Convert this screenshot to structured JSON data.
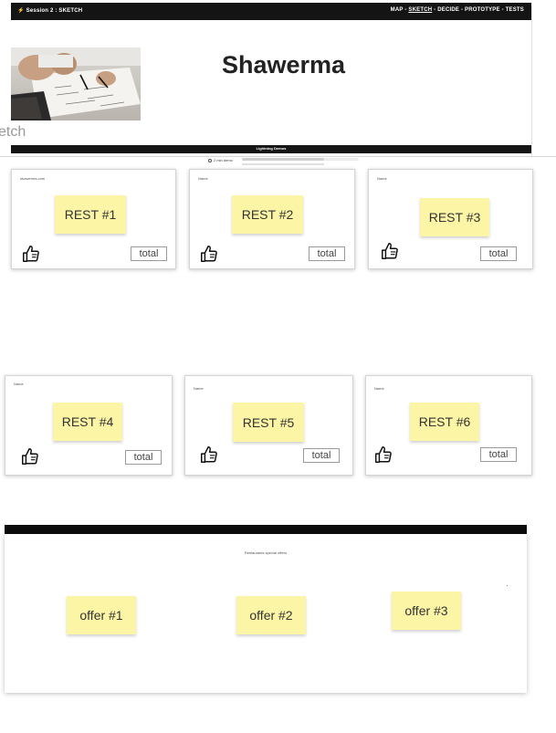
{
  "header": {
    "session_label": "Session 2 : SKETCH",
    "steps": [
      {
        "label": "MAP",
        "current": false
      },
      {
        "label": "SKETCH",
        "current": true
      },
      {
        "label": "DECIDE",
        "current": false
      },
      {
        "label": "PROTOTYPE",
        "current": false
      },
      {
        "label": "TESTS",
        "current": false
      }
    ],
    "separator": " - "
  },
  "board": {
    "title": "Shawerma",
    "side_text": "etch",
    "bar_label": "Lightning Demos",
    "mini_label": "2 min demo"
  },
  "restaurants": [
    {
      "name": "shawerma.com",
      "sticky": "REST #1",
      "total": "total"
    },
    {
      "name": "Name",
      "sticky": "REST #2",
      "total": "total"
    },
    {
      "name": "Name",
      "sticky": "REST #3",
      "total": "total"
    },
    {
      "name": "Name",
      "sticky": "REST #4",
      "total": "total"
    },
    {
      "name": "Name",
      "sticky": "REST #5",
      "total": "total"
    },
    {
      "name": "Name",
      "sticky": "REST #6",
      "total": "total"
    }
  ],
  "offers": {
    "caption": "Restaurants special offers",
    "items": [
      {
        "label": "offer #1"
      },
      {
        "label": "offer #2"
      },
      {
        "label": "offer #3"
      }
    ]
  },
  "icons": {
    "bolt": "lightning-bolt-icon",
    "thumb": "thumbs-up-icon",
    "timer": "timer-icon"
  },
  "colors": {
    "sticky": "#fbf5a5",
    "bar": "#141414",
    "accent_bolt": "#f5c518"
  }
}
